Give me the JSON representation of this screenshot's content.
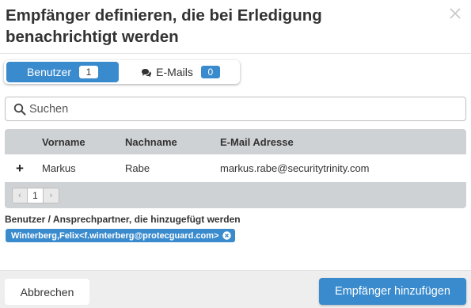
{
  "dialog": {
    "title": "Empfänger definieren, die bei Erledigung benachrichtigt werden"
  },
  "tabs": [
    {
      "label": "Benutzer",
      "count": "1",
      "active": true,
      "icon": null
    },
    {
      "label": "E-Mails",
      "count": "0",
      "active": false,
      "icon": "comments-icon"
    }
  ],
  "search": {
    "placeholder": "Suchen",
    "value": ""
  },
  "table": {
    "columns": [
      "",
      "Vorname",
      "Nachname",
      "E-Mail Adresse"
    ],
    "rows": [
      {
        "action": "+",
        "vorname": "Markus",
        "nachname": "Rabe",
        "email": "markus.rabe@securitytrinity.com"
      }
    ],
    "pager": {
      "prev": "‹",
      "current": "1",
      "next": "›"
    }
  },
  "selected": {
    "label": "Benutzer / Ansprechpartner, die hinzugefügt werden",
    "chips": [
      {
        "text": "Winterberg,Felix<f.winterberg@protecguard.com>"
      }
    ]
  },
  "footer": {
    "cancel_label": "Abbrechen",
    "submit_label": "Empfänger hinzufügen"
  },
  "colors": {
    "accent": "#3a8bcd",
    "header_bg": "#cfd2d4",
    "footer_bg": "#eeeeee"
  }
}
